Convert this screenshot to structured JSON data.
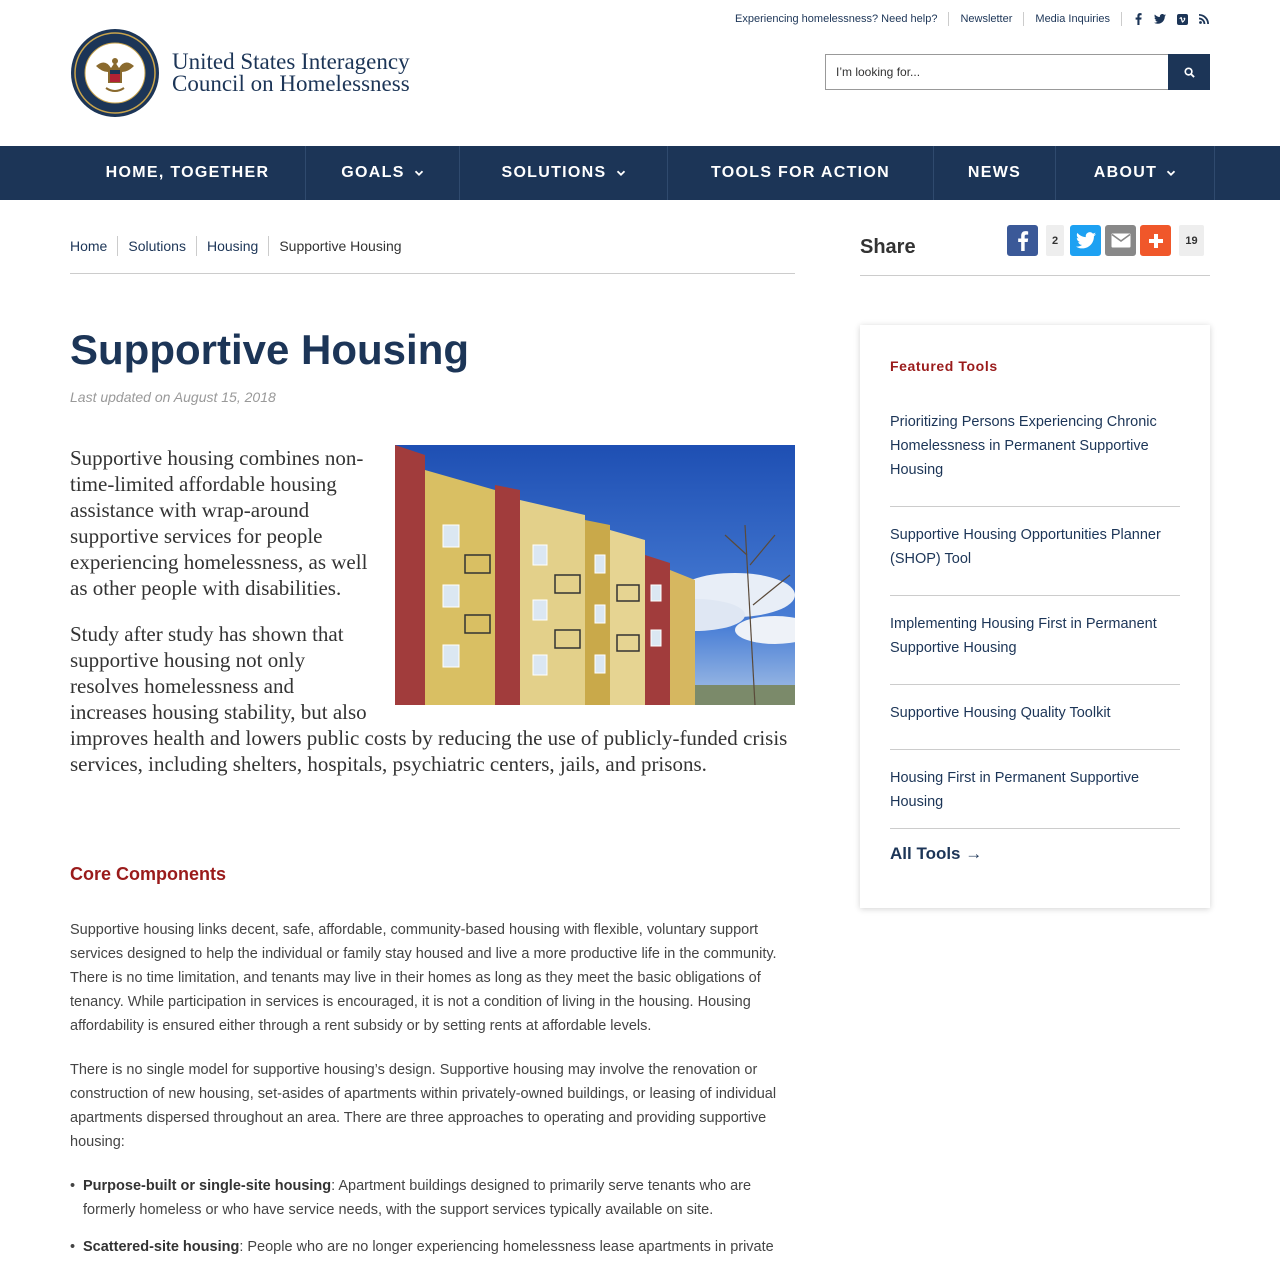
{
  "utility": {
    "links": [
      "Experiencing homelessness? Need help?",
      "Newsletter",
      "Media Inquiries"
    ],
    "social": [
      "facebook-icon",
      "twitter-icon",
      "vimeo-icon",
      "rss-icon"
    ]
  },
  "site": {
    "name_line1": "United States Interagency",
    "name_line2": "Council on Homelessness"
  },
  "search": {
    "placeholder": "I’m looking for...",
    "icon": "search-icon"
  },
  "nav": [
    {
      "label": "HOME, TOGETHER",
      "dropdown": false
    },
    {
      "label": "GOALS",
      "dropdown": true
    },
    {
      "label": "SOLUTIONS",
      "dropdown": true
    },
    {
      "label": "TOOLS FOR ACTION",
      "dropdown": false
    },
    {
      "label": "NEWS",
      "dropdown": false
    },
    {
      "label": "ABOUT",
      "dropdown": true
    }
  ],
  "breadcrumb": [
    "Home",
    "Solutions",
    "Housing",
    "Supportive Housing"
  ],
  "share": {
    "label": "Share",
    "facebook_count": "2",
    "total_count": "19",
    "colors": {
      "facebook": "#3b5998",
      "twitter": "#1da1f2",
      "email": "#888888",
      "more": "#f0572a"
    }
  },
  "page": {
    "title": "Supportive Housing",
    "updated": "Last updated on August 15, 2018",
    "lead": [
      "Supportive housing combines non-time-limited affordable housing assistance with wrap-around supportive services for people experiencing homelessness, as well as other people with disabilities.",
      "Study after study has shown that supportive housing not only resolves homelessness and increases housing stability, but also improves health and lowers public costs by reducing the use of publicly-funded crisis services, including shelters, hospitals, psychiatric centers, jails, and prisons."
    ],
    "section_title": "Core Components",
    "paragraphs": [
      "Supportive housing links decent, safe, affordable, community-based housing with flexible, voluntary support services designed to help the individual or family stay housed and live a more productive life in the community. There is no time limitation, and tenants may live in their homes as long as they meet the basic obligations of tenancy. While participation in services is encouraged, it is not a condition of living in the housing. Housing affordability is ensured either through a rent subsidy or by setting rents at affordable levels.",
      "There is no single model for supportive housing’s design. Supportive housing may involve the renovation or construction of new housing, set-asides of apartments within privately-owned buildings, or leasing of individual apartments dispersed throughout an area. There are three approaches to operating and providing supportive housing:"
    ],
    "bullets": [
      {
        "term": "Purpose-built or single-site housing",
        "text": ": Apartment buildings designed to primarily serve tenants who are formerly homeless or who have service needs, with the support services typically available on site."
      },
      {
        "term": "Scattered-site housing",
        "text": ": People who are no longer experiencing homelessness lease apartments in private"
      }
    ]
  },
  "featured": {
    "title": "Featured Tools",
    "tools": [
      "Prioritizing Persons Experiencing Chronic Homelessness in Permanent Supportive Housing",
      "Supportive Housing Opportunities Planner (SHOP) Tool",
      "Implementing Housing First in Permanent Supportive Housing",
      "Supportive Housing Quality Toolkit",
      "Housing First in Permanent Supportive Housing"
    ],
    "all_tools": "All Tools →"
  },
  "colors": {
    "navy": "#1c3557",
    "accent_red": "#9a1b1b"
  }
}
